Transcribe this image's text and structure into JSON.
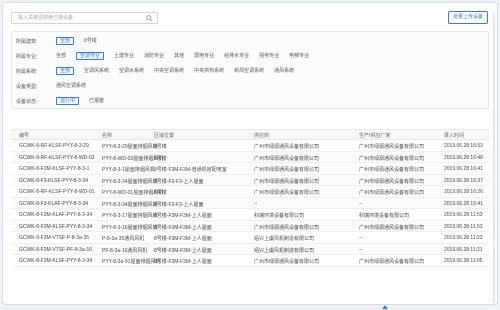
{
  "search": {
    "placeholder": "输入关键词搜索已接设备"
  },
  "add_button": "批量上传设备",
  "filters": [
    {
      "label": "所属建筑:",
      "options": [
        "全部",
        "8号楼"
      ],
      "active": 0
    },
    {
      "label": "所属专业:",
      "options": [
        "全部",
        "空调专业",
        "土建专业",
        "消防专业",
        "其他",
        "弱电专业",
        "给排水专业",
        "强电专业",
        "电梯专业"
      ],
      "active": 1
    },
    {
      "label": "所属系统:",
      "options": [
        "全部",
        "空调风系统",
        "空调水系统",
        "中央空调系统",
        "中央供热系统",
        "新风空调系统",
        "通风系统"
      ],
      "active": 0
    },
    {
      "label": "设备类型:",
      "options": [
        "通风空调系统"
      ],
      "active": -1
    },
    {
      "label": "设备状态:",
      "options": [
        "运行中",
        "已报废"
      ],
      "active": 0
    }
  ],
  "table": {
    "headers": [
      "编号",
      "名称",
      "区域位置",
      "供应商",
      "生产/供应厂家",
      "录入时间"
    ],
    "rows": [
      [
        "GCWK-8-RF-KLSF-PYY-8-3-29",
        "PYY-8-3-29屋面排烟风机",
        "8号楼",
        "广州市绿源通风设备有限公司",
        "广州市绿源通风设备有限公司",
        "2019.06.28 16:53"
      ],
      [
        "GCWK-8-RF-KLSF-PYY-8-WD-03",
        "PYY-8-WD-03屋面排烟风机",
        "8号楼",
        "广州市绿源通风设备有限公司",
        "广州市绿源通风设备有限公司",
        "2019.06.28 16:48"
      ],
      [
        "GCWK-8-F3M-KLSF-PYY-8-3-1",
        "PYY-8-3-1屋面排烟风机",
        "8号楼-F3M-F3M-普通机房配电室",
        "广州市绿源通风设备有限公司",
        "广州市绿源通风设备有限公司",
        "2019.06.28 16:41"
      ],
      [
        "GCWK-8-F3-KLSF-PYY-8-3-34",
        "PYY-8-3-34屋面排烟风机",
        "8号楼-F3-F3-上人屋面",
        "广州市绿源通风设备有限公司",
        "广州市绿源通风设备有限公司",
        "2019.06.28 16:37"
      ],
      [
        "GCWK-8-RF-KLSF-PYY-8-WD-01",
        "PYY-8-WD-01屋面排烟风机",
        "8号楼",
        "广州市绿源通风设备有限公司",
        "广州市绿源通风设备有限公司",
        "2019.06.28 16:26"
      ],
      [
        "GCWK-8-F3-KLAF-PYY-8-3-34",
        "PYY-8-3-34屋面排烟风机",
        "8号楼-F3-F3-上人屋面",
        "--",
        "--",
        "2019.06.28 15:41"
      ],
      [
        "GCWK-8-F3M-KLAF-PYY-8-3-34",
        "PYY-8-3-17屋面排烟风机",
        "8号楼-F3M-F3M-上人屋面",
        "科瑞环境设备有限公司",
        "科瑞环境设备有限公司",
        "2019.06.28 11:53"
      ],
      [
        "GCWK-8-F3M-KLSF-PYY-8-3-34",
        "PYY-8-3-16屋面排烟风机",
        "8号楼-F3M-F3M-上人屋面",
        "广州市绿源通风设备有限公司",
        "广州市绿源通风设备有限公司",
        "2019.06.28 11:53"
      ],
      [
        "GCWK-8-F3M-VTSF-P-8-3a-35",
        "P-8-3a-35通风风机",
        "8号楼-F3M-F3M-上人屋面",
        "绍兴上虞风机制造有限公司",
        "--",
        "2019.06.28 11:23"
      ],
      [
        "GCWK-8-F3M-VTSF-PF-8-3a-16",
        "PF-8-3a-16通风风机",
        "8号楼-F3M-F3M-上人屋面",
        "绍兴上虞风机制造有限公司",
        "--",
        "2019.06.28 11:21"
      ],
      [
        "GCWK-8-F3M-KLSF-PYY-8-3-34",
        "PYY-8-3a-91屋面排烟风机",
        "8号楼-F3M-F3M-上人屋面",
        "广州市绿源通风设备有限公司",
        "广州市绿源通风设备有限公司",
        "2019.06.28 11:05"
      ]
    ]
  },
  "colors": {
    "accent": "#3b7ad9",
    "border": "#d8dde5"
  },
  "icons": {
    "search": "search-icon"
  }
}
